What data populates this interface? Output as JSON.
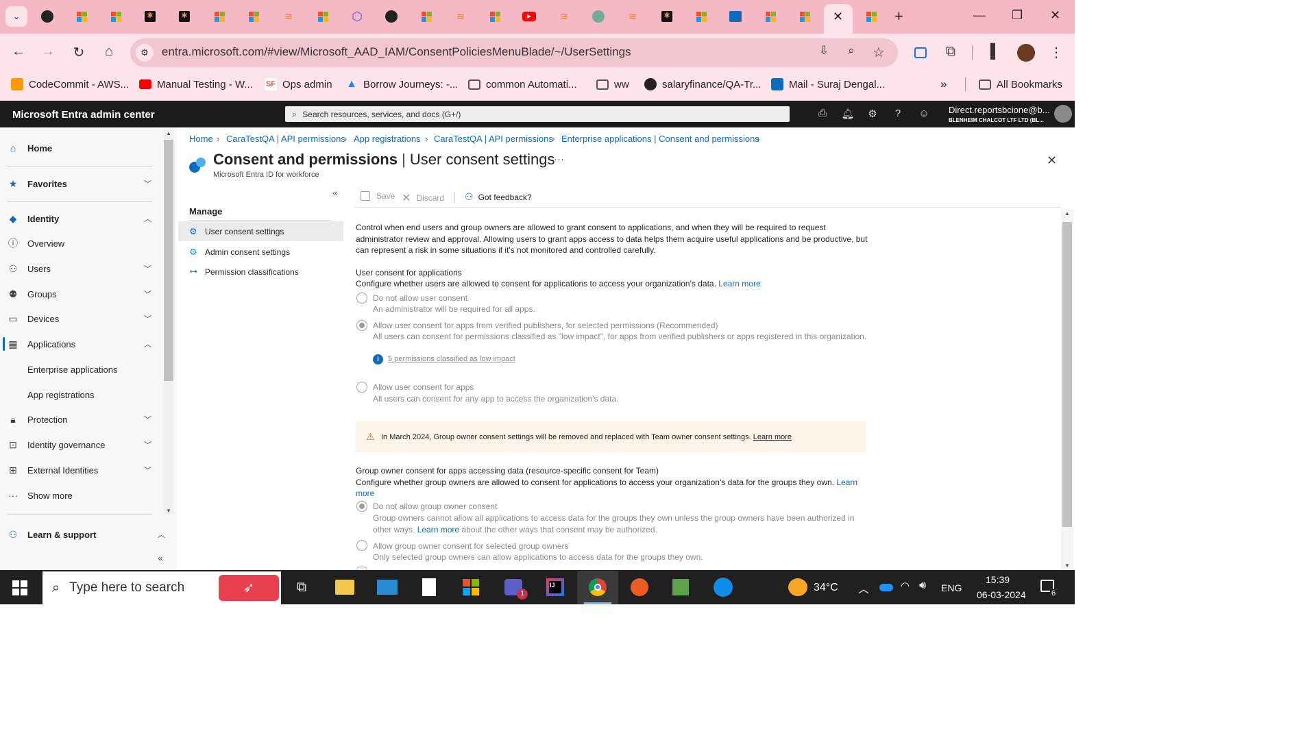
{
  "browser": {
    "url": "entra.microsoft.com/#view/Microsoft_AAD_IAM/ConsentPoliciesMenuBlade/~/UserSettings",
    "bookmarks": [
      {
        "label": "CodeCommit - AWS...",
        "icon": "aws-icon",
        "color": "#ff9900"
      },
      {
        "label": "Manual Testing - W...",
        "icon": "youtube-icon",
        "color": "#ff0000"
      },
      {
        "label": "Ops admin",
        "icon": "salesforce-icon",
        "color": "#e8593c"
      },
      {
        "label": "Borrow Journeys: -...",
        "icon": "atlassian-icon",
        "color": "#2684ff"
      },
      {
        "label": "common Automati...",
        "icon": "folder-icon",
        "color": "#555555"
      },
      {
        "label": "ww",
        "icon": "folder-icon",
        "color": "#555555"
      },
      {
        "label": "salaryfinance/QA-Tr...",
        "icon": "github-icon",
        "color": "#222222"
      },
      {
        "label": "Mail - Suraj Dengal...",
        "icon": "outlook-icon",
        "color": "#0f6cbd"
      }
    ],
    "all_bookmarks": "All Bookmarks"
  },
  "portal": {
    "app_title": "Microsoft Entra admin center",
    "search_placeholder": "Search resources, services, and docs (G+/)",
    "account_name": "Direct.reportsbcione@b...",
    "account_org": "BLENHEIM CHALCOT LTF LTD (BL..."
  },
  "leftnav": {
    "home": "Home",
    "favorites": "Favorites",
    "identity": "Identity",
    "overview": "Overview",
    "users": "Users",
    "groups": "Groups",
    "devices": "Devices",
    "applications": "Applications",
    "enterprise_apps": "Enterprise applications",
    "app_registrations": "App registrations",
    "protection": "Protection",
    "identity_governance": "Identity governance",
    "external_identities": "External Identities",
    "show_more": "Show more",
    "learn_support": "Learn & support"
  },
  "breadcrumb": [
    "Home",
    "CaraTestQA | API permissions",
    "App registrations",
    "CaraTestQA | API permissions",
    "Enterprise applications | Consent and permissions"
  ],
  "blade": {
    "title": "Consent and permissions",
    "subtitle_part": "User consent settings",
    "service": "Microsoft Entra ID for workforce",
    "more": "···"
  },
  "manage": {
    "heading": "Manage",
    "items": [
      "User consent settings",
      "Admin consent settings",
      "Permission classifications"
    ]
  },
  "commands": {
    "save": "Save",
    "discard": "Discard",
    "feedback": "Got feedback?"
  },
  "content": {
    "intro": "Control when end users and group owners are allowed to grant consent to applications, and when they will be required to request administrator review and approval. Allowing users to grant apps access to data helps them acquire useful applications and be productive, but can represent a risk in some situations if it's not monitored and controlled carefully.",
    "user_consent_heading": "User consent for applications",
    "user_consent_desc": "Configure whether users are allowed to consent for applications to access your organization's data.",
    "learn_more": "Learn more",
    "options": [
      {
        "label": "Do not allow user consent",
        "desc": "An administrator will be required for all apps."
      },
      {
        "label": "Allow user consent for apps from verified publishers, for selected permissions (Recommended)",
        "desc": "All users can consent for permissions classified as \"low impact\", for apps from verified publishers or apps registered in this organization."
      },
      {
        "label": "Allow user consent for apps",
        "desc": "All users can consent for any app to access the organization's data."
      }
    ],
    "low_impact_link": "5 permissions classified as low impact",
    "warning": "In March 2024, Group owner consent settings will be removed and replaced with Team owner consent settings.",
    "group_heading": "Group owner consent for apps accessing data (resource-specific consent for Team)",
    "group_desc": "Configure whether group owners are allowed to consent for applications to access your organization's data for the groups they own.",
    "learn": "Learn",
    "more": "more",
    "group_options": [
      {
        "label": "Do not allow group owner consent",
        "desc_a": "Group owners cannot allow all applications to access data for the groups they own unless the group owners have been authorized in",
        "desc_b_prefix": "other ways.",
        "desc_b_suffix": "about the other ways that consent may be authorized."
      },
      {
        "label": "Allow group owner consent for selected group owners",
        "desc": "Only selected group owners can allow applications to access data for the groups they own."
      }
    ]
  },
  "taskbar": {
    "search_placeholder": "Type here to search",
    "temperature": "34°C",
    "language": "ENG",
    "time": "15:39",
    "date": "06-03-2024",
    "notifications": "6",
    "teams_badge": "1"
  }
}
